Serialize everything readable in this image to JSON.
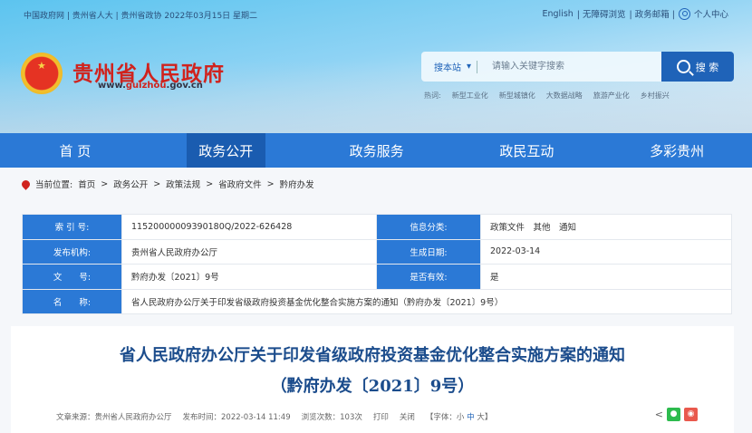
{
  "topbar": {
    "left": "中国政府网 | 贵州省人大 | 贵州省政协  2022年03月15日   星期二",
    "english": "English",
    "accessible": "| 无障碍浏览",
    "mail": "| 政务邮箱 |",
    "user": "个人中心"
  },
  "site": {
    "name": "贵州省人民政府",
    "url_pre": "www.",
    "url_mid": "guizhou",
    "url_post": ".gov.cn"
  },
  "search": {
    "scope": "搜本站",
    "placeholder": "请输入关键字搜索",
    "button": "搜 索",
    "hot_label": "热词:",
    "hot": [
      "新型工业化",
      "新型城镇化",
      "大数据战略",
      "旅游产业化",
      "乡村振兴"
    ]
  },
  "nav": [
    "首 页",
    "政务公开",
    "政务服务",
    "政民互动",
    "多彩贵州"
  ],
  "breadcrumb": {
    "label": "当前位置:",
    "items": [
      "首页",
      ">",
      "政务公开",
      ">",
      "政策法规",
      ">",
      "省政府文件",
      ">",
      "黔府办发"
    ]
  },
  "meta": {
    "index_k": "索 引 号:",
    "index_v": "11520000009390180Q/2022-626428",
    "cat_k": "信息分类:",
    "cat_v": "政策文件　其他　通知",
    "org_k": "发布机构:",
    "org_v": "贵州省人民政府办公厅",
    "date_k": "生成日期:",
    "date_v": "2022-03-14",
    "num_k": "文　　号:",
    "num_v": "黔府办发〔2021〕9号",
    "valid_k": "是否有效:",
    "valid_v": "是",
    "name_k": "名　　称:",
    "name_v": "省人民政府办公厅关于印发省级政府投资基金优化整合实施方案的通知（黔府办发〔2021〕9号）"
  },
  "article": {
    "title1": "省人民政府办公厅关于印发省级政府投资基金优化整合实施方案的通知",
    "title2": "（黔府办发〔2021〕9号）",
    "source": "文章来源：贵州省人民政府办公厅",
    "time": "发布时间：2022-03-14 11:49",
    "views": "浏览次数：103次",
    "print": "打印",
    "close": "关闭",
    "font_pre": "【字体：",
    "font_s": "小",
    "font_m": "中",
    "font_l": "大】"
  }
}
